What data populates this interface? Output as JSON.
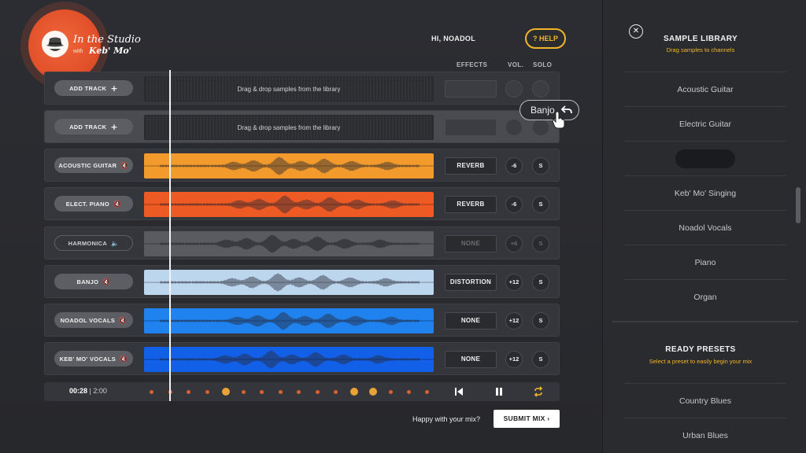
{
  "brand": {
    "title": "In the Studio",
    "with": "with",
    "artist": "Keb' Mo'"
  },
  "header": {
    "greeting": "HI, NOADOL",
    "help_label": "? HELP"
  },
  "columns": {
    "effects": "EFFECTS",
    "vol": "VOL.",
    "solo": "SOLO"
  },
  "tracks": [
    {
      "label": "ADD TRACK",
      "icon": "plus-icon",
      "type": "empty",
      "lane_text": "Drag & drop samples from the library",
      "effect": "",
      "vol": "",
      "solo": ""
    },
    {
      "label": "ADD TRACK",
      "icon": "plus-icon",
      "type": "empty",
      "lane_text": "Drag & drop samples from the library",
      "effect": "",
      "vol": "",
      "solo": ""
    },
    {
      "label": "ACOUSTIC GUITAR",
      "icon": "mute-icon",
      "type": "wave",
      "color": "#f39a2c",
      "effect": "REVERB",
      "vol": "-6",
      "solo": "S"
    },
    {
      "label": "ELECT. PIANO",
      "icon": "mute-icon",
      "type": "wave",
      "color": "#ee5a23",
      "effect": "REVERB",
      "vol": "-6",
      "solo": "S"
    },
    {
      "label": "HARMONICA",
      "icon": "speaker-icon",
      "type": "wave",
      "color": "#5a5b61",
      "effect": "NONE",
      "vol": "+6",
      "solo": "S"
    },
    {
      "label": "BANJO",
      "icon": "mute-icon",
      "type": "wave",
      "color": "#bcd6ee",
      "effect": "DISTORTION",
      "vol": "+12",
      "solo": "S"
    },
    {
      "label": "NOADOL VOCALS",
      "icon": "mute-icon",
      "type": "wave",
      "color": "#1f82ef",
      "effect": "NONE",
      "vol": "+12",
      "solo": "S"
    },
    {
      "label": "KEB' MO' VOCALS",
      "icon": "mute-icon",
      "type": "wave",
      "color": "#1360e8",
      "effect": "NONE",
      "vol": "+12",
      "solo": "S"
    }
  ],
  "transport": {
    "current": "00:28",
    "total": "| 2:00"
  },
  "drag_tooltip": {
    "label": "Banjo"
  },
  "footer": {
    "prompt": "Happy with your mix?",
    "submit_label": "SUBMIT MIX ›"
  },
  "library": {
    "title": "SAMPLE LIBRARY",
    "subtitle": "Drag samples to channels",
    "items": [
      "Acoustic Guitar",
      "Electric Guitar",
      "",
      "Keb' Mo' Singing",
      "Noadol Vocals",
      "Piano",
      "Organ"
    ]
  },
  "presets": {
    "title": "READY PRESETS",
    "subtitle": "Select a preset to easily begin your mix",
    "items": [
      "Country Blues",
      "Urban Blues"
    ]
  },
  "colors": {
    "accent": "#f1b52a",
    "brand": "#e2512a"
  }
}
